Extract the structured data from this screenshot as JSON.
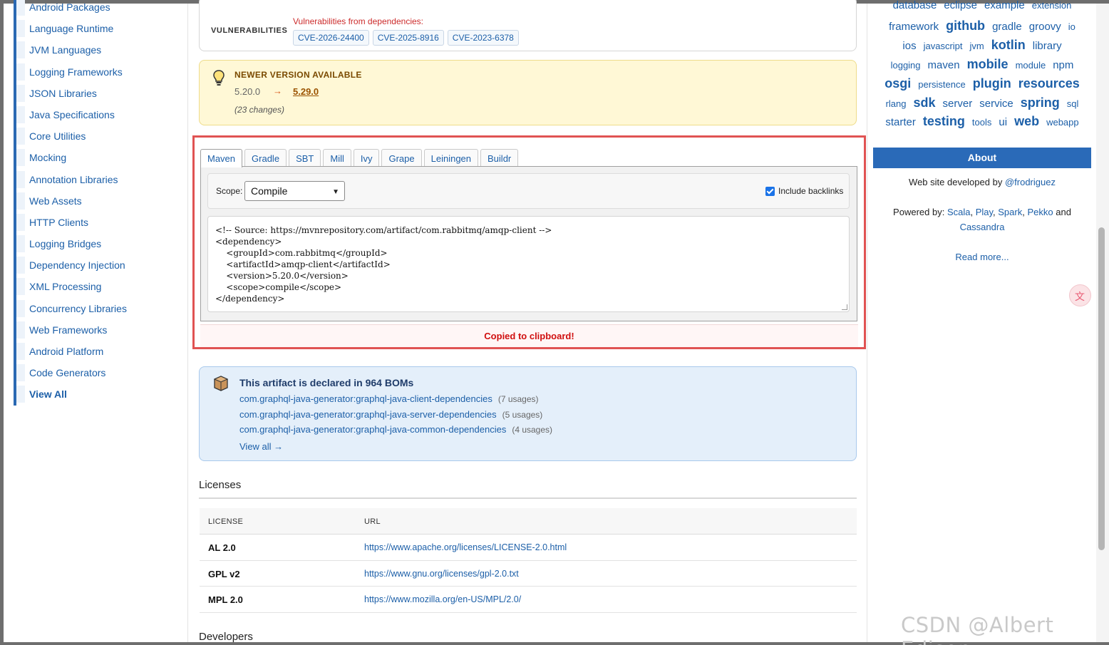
{
  "categories": [
    "Android Packages",
    "Language Runtime",
    "JVM Languages",
    "Logging Frameworks",
    "JSON Libraries",
    "Java Specifications",
    "Core Utilities",
    "Mocking",
    "Annotation Libraries",
    "Web Assets",
    "HTTP Clients",
    "Logging Bridges",
    "Dependency Injection",
    "XML Processing",
    "Concurrency Libraries",
    "Web Frameworks",
    "Android Platform",
    "Code Generators",
    "View All"
  ],
  "vulnerabilities": {
    "label": "VULNERABILITIES",
    "title": "Vulnerabilities from dependencies:",
    "cves": [
      "CVE-2026-24400",
      "CVE-2025-8916",
      "CVE-2023-6378"
    ]
  },
  "newer_version": {
    "title": "NEWER VERSION AVAILABLE",
    "old": "5.20.0",
    "arrow": "→",
    "new": "5.29.0",
    "changes": "(23 changes)"
  },
  "snippet": {
    "tabs": [
      "Maven",
      "Gradle",
      "SBT",
      "Mill",
      "Ivy",
      "Grape",
      "Leiningen",
      "Buildr"
    ],
    "active_tab": "Maven",
    "scope_label": "Scope:",
    "scope_value": "Compile",
    "backlinks_label": "Include backlinks",
    "backlinks_checked": true,
    "code": "<!-- Source: https://mvnrepository.com/artifact/com.rabbitmq/amqp-client -->\n<dependency>\n    <groupId>com.rabbitmq</groupId>\n    <artifactId>amqp-client</artifactId>\n    <version>5.20.0</version>\n    <scope>compile</scope>\n</dependency>",
    "copied": "Copied to clipboard!"
  },
  "boms": {
    "title": "This artifact is declared in 964 BOMs",
    "items": [
      {
        "name": "com.graphql-java-generator:graphql-java-client-dependencies",
        "usage": "(7 usages)"
      },
      {
        "name": "com.graphql-java-generator:graphql-java-server-dependencies",
        "usage": "(5 usages)"
      },
      {
        "name": "com.graphql-java-generator:graphql-java-common-dependencies",
        "usage": "(4 usages)"
      }
    ],
    "view_all": "View all →"
  },
  "licenses": {
    "heading": "Licenses",
    "col_license": "LICENSE",
    "col_url": "URL",
    "rows": [
      {
        "name": "AL 2.0",
        "url": "https://www.apache.org/licenses/LICENSE-2.0.html"
      },
      {
        "name": "GPL v2",
        "url": "https://www.gnu.org/licenses/gpl-2.0.txt"
      },
      {
        "name": "MPL 2.0",
        "url": "https://www.mozilla.org/en-US/MPL/2.0/"
      }
    ]
  },
  "developers_heading": "Developers",
  "tag_cloud": [
    [
      "database",
      "eclipse",
      "example",
      "extension"
    ],
    [
      "framework",
      "github",
      "gradle",
      "groovy",
      "io"
    ],
    [
      "ios",
      "javascript",
      "jvm",
      "kotlin",
      "library"
    ],
    [
      "logging",
      "maven",
      "mobile",
      "module",
      "npm"
    ],
    [
      "osgi",
      "persistence",
      "plugin",
      "resources"
    ],
    [
      "rlang",
      "sdk",
      "server",
      "service",
      "spring",
      "sql"
    ],
    [
      "starter",
      "testing",
      "tools",
      "ui",
      "web",
      "webapp"
    ]
  ],
  "about": {
    "button": "About",
    "developed_by": "Web site developed by",
    "developer": "@frodriguez",
    "powered_by": "Powered by:",
    "powered_items": [
      "Scala",
      "Play",
      "Spark",
      "Pekko"
    ],
    "powered_and": "and",
    "powered_last": "Cassandra",
    "read_more": "Read more..."
  },
  "watermark": "CSDN @Albert Edison"
}
